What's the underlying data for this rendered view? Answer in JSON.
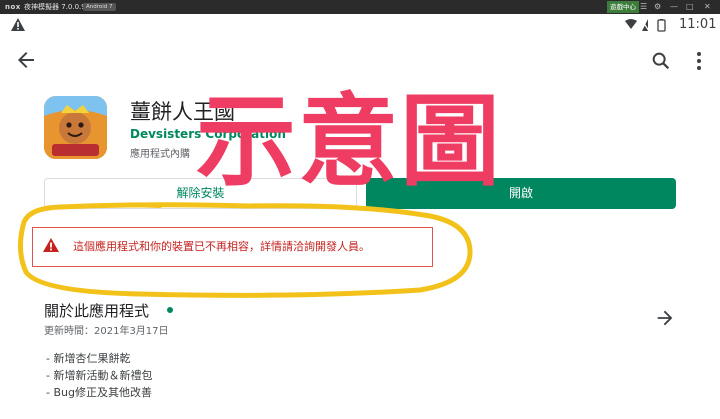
{
  "emulator": {
    "logo": "nox",
    "title": "夜神模擬器 7.0.0.9",
    "android_badge": "Android 7",
    "game_center": "遊戲中心"
  },
  "status_bar": {
    "time": "11:01"
  },
  "app": {
    "title": "薑餅人王國",
    "developer": "Devsisters Corporation",
    "subtitle": "應用程式內購",
    "uninstall_label": "解除安裝",
    "open_label": "開啟"
  },
  "warning": {
    "text": "這個應用程式和你的裝置已不再相容，詳情請洽詢開發人員。"
  },
  "about": {
    "title": "關於此應用程式",
    "updated": "更新時間：2021年3月17日",
    "changes": [
      "- 新增杏仁果餅乾",
      "- 新增新活動＆新禮包",
      "- Bug修正及其他改善"
    ]
  },
  "overlay": {
    "stamp_text": "示意圖",
    "stamp_color": "#ef3c62",
    "highlight_color": "#f2c21b"
  },
  "colors": {
    "accent": "#01875f",
    "error": "#c5221f"
  }
}
